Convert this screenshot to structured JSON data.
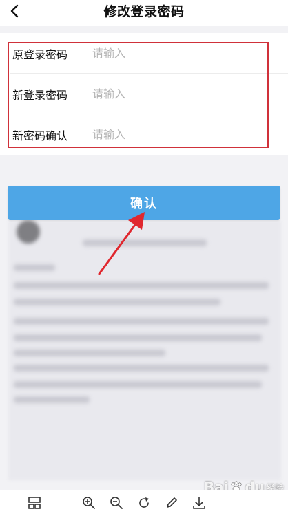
{
  "header": {
    "title": "修改登录密码",
    "back_icon": "chevron-left-icon"
  },
  "form": {
    "rows": [
      {
        "label": "原登录密码",
        "placeholder": "请输入"
      },
      {
        "label": "新登录密码",
        "placeholder": "请输入"
      },
      {
        "label": "新密码确认",
        "placeholder": "请输入"
      }
    ],
    "highlight_color": "#d0313a"
  },
  "confirm_button": {
    "label": "确认",
    "color": "#4ea6e6"
  },
  "annotation": {
    "arrow_color": "#e0272e"
  },
  "toolbar": {
    "icons": [
      "layout-icon",
      "zoom-in-icon",
      "zoom-out-icon",
      "rotate-icon",
      "edit-icon",
      "download-icon"
    ]
  },
  "watermark": {
    "text": "Bai",
    "paw": "du",
    "sub": "经验"
  }
}
